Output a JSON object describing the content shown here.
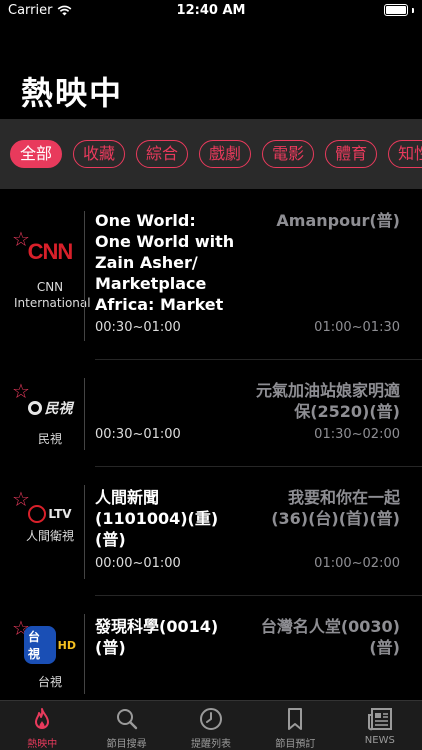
{
  "status_bar": {
    "carrier": "Carrier",
    "time": "12:40 AM"
  },
  "title": "熱映中",
  "filters": [
    "全部",
    "收藏",
    "綜合",
    "戲劇",
    "電影",
    "體育",
    "知性"
  ],
  "active_filter": "全部",
  "channels": [
    {
      "logo": "CNN",
      "name": "CNN International",
      "current_title": "One World: One World with Zain Asher/ Marketplace Africa: Market",
      "current_time": "00:30~01:00",
      "next_title": "Amanpour(普)",
      "next_time": "01:00~01:30"
    },
    {
      "logo": "民視",
      "name": "民視",
      "current_title": "",
      "current_time": "00:30~01:00",
      "next_title": "元氣加油站娘家明適保(2520)(普)",
      "next_time": "01:30~02:00"
    },
    {
      "logo": "LTV",
      "name": "人間衛視",
      "current_title": "人間新聞 (1101004)(重) (普)",
      "current_time": "00:00~01:00",
      "next_title": "我要和你在一起 (36)(台)(首)(普)",
      "next_time": "01:00~02:00"
    },
    {
      "logo": "台視",
      "name": "台視",
      "current_title": "發現科學(0014) (普)",
      "current_time": "",
      "next_title": "台灣名人堂(0030) (普)",
      "next_time": ""
    }
  ],
  "tabs": [
    {
      "label": "熱映中",
      "icon": "flame-icon"
    },
    {
      "label": "節目搜尋",
      "icon": "search-icon"
    },
    {
      "label": "提醒列表",
      "icon": "clock-icon"
    },
    {
      "label": "節目預訂",
      "icon": "bookmark-icon"
    },
    {
      "label": "NEWS",
      "icon": "newspaper-icon"
    }
  ],
  "colors": {
    "accent": "#e83a5c",
    "background": "#000000",
    "filter_bar": "#2a2a2a",
    "secondary_text": "#8e8e93"
  }
}
